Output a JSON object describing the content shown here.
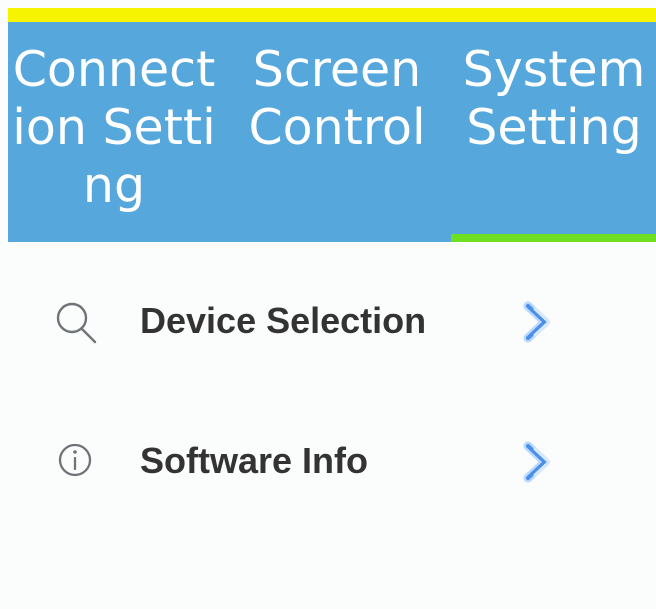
{
  "tabs": [
    {
      "label": "Connection Setting",
      "active": false
    },
    {
      "label": "Screen Control",
      "active": false
    },
    {
      "label": "System Setting",
      "active": true
    }
  ],
  "menu": {
    "items": [
      {
        "label": "Device Selection",
        "icon": "search-icon",
        "action_icon": "chevron-right-icon"
      },
      {
        "label": "Software Info",
        "icon": "info-icon",
        "action_icon": "chevron-right-icon"
      }
    ]
  },
  "colors": {
    "top_bar": "#f7f400",
    "tab_background": "#55a7dc",
    "tab_text": "#ffffff",
    "active_indicator": "#6ee021",
    "content_background": "#fbfcfc",
    "label_text": "#333333",
    "icon_gray": "#6f7478",
    "arrow_blue": "#4b8fe8"
  }
}
